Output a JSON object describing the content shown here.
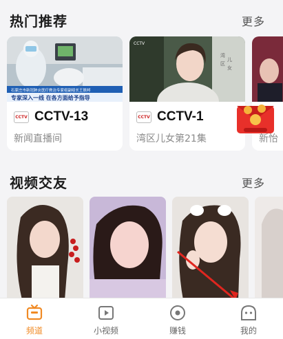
{
  "hot": {
    "title": "热门推荐",
    "more": "更多"
  },
  "channels": [
    {
      "logo": "CCTV",
      "name": "CCTV-13",
      "program": "新闻直播间",
      "caption_top": "石家庄市新冠肺炎医疗救治专家组副组长王振邦",
      "caption_main": "专家深入一线 在各方面给予指导"
    },
    {
      "logo": "CCTV",
      "name": "CCTV-1",
      "program": "湾区儿女第21集"
    },
    {
      "program": "新怡"
    }
  ],
  "videos": {
    "title": "视频交友",
    "more": "更多"
  },
  "tabs": [
    {
      "label": "频道",
      "icon": "channel-icon",
      "active": true
    },
    {
      "label": "小视频",
      "icon": "short-video-icon",
      "active": false
    },
    {
      "label": "赚钱",
      "icon": "earn-icon",
      "active": false
    },
    {
      "label": "我的",
      "icon": "profile-icon",
      "active": false
    }
  ],
  "colors": {
    "accent": "#f08a24",
    "red_packet": "#e8302a"
  }
}
